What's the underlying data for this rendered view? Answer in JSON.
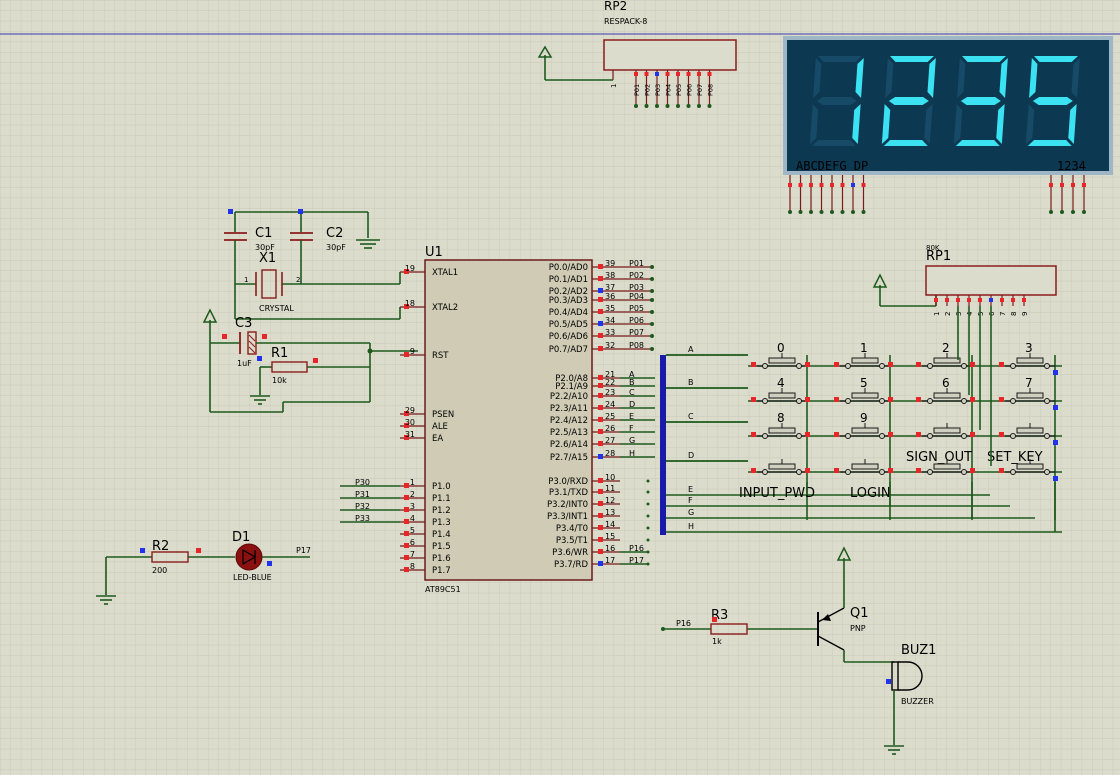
{
  "rp2": {
    "ref": "RP2",
    "value": "RESPACK-8",
    "pins": [
      "1"
    ],
    "outs": [
      "P01",
      "P02",
      "P03",
      "P04",
      "P05",
      "P06",
      "P07",
      "P08"
    ]
  },
  "display": {
    "digits": [
      "1",
      "2",
      "3",
      "5"
    ],
    "seg_label": "ABCDEFG DP",
    "digit_label": "1234"
  },
  "c1": {
    "ref": "C1",
    "value": "30pF"
  },
  "c2": {
    "ref": "C2",
    "value": "30pF"
  },
  "x1": {
    "ref": "X1",
    "value": "CRYSTAL",
    "pin1": "1",
    "pin2": "2"
  },
  "c3": {
    "ref": "C3",
    "value": "1uF"
  },
  "r1": {
    "ref": "R1",
    "value": "10k"
  },
  "u1": {
    "ref": "U1",
    "part": "AT89C51",
    "left": [
      {
        "num": "19",
        "name": "XTAL1"
      },
      {
        "num": "18",
        "name": "XTAL2"
      },
      {
        "num": "9",
        "name": "RST"
      },
      {
        "num": "29",
        "name": "PSEN"
      },
      {
        "num": "30",
        "name": "ALE"
      },
      {
        "num": "31",
        "name": "EA"
      },
      {
        "num": "1",
        "name": "P1.0",
        "net": "P30"
      },
      {
        "num": "2",
        "name": "P1.1",
        "net": "P31"
      },
      {
        "num": "3",
        "name": "P1.2",
        "net": "P32"
      },
      {
        "num": "4",
        "name": "P1.3",
        "net": "P33"
      },
      {
        "num": "5",
        "name": "P1.4"
      },
      {
        "num": "6",
        "name": "P1.5"
      },
      {
        "num": "7",
        "name": "P1.6"
      },
      {
        "num": "8",
        "name": "P1.7"
      }
    ],
    "right": [
      {
        "num": "39",
        "name": "P0.0/AD0",
        "net": "P01"
      },
      {
        "num": "38",
        "name": "P0.1/AD1",
        "net": "P02"
      },
      {
        "num": "37",
        "name": "P0.2/AD2",
        "net": "P03"
      },
      {
        "num": "36",
        "name": "P0.3/AD3",
        "net": "P04"
      },
      {
        "num": "35",
        "name": "P0.4/AD4",
        "net": "P05"
      },
      {
        "num": "34",
        "name": "P0.5/AD5",
        "net": "P06"
      },
      {
        "num": "33",
        "name": "P0.6/AD6",
        "net": "P07"
      },
      {
        "num": "32",
        "name": "P0.7/AD7",
        "net": "P08"
      },
      {
        "num": "21",
        "name": "P2.0/A8",
        "net": "A"
      },
      {
        "num": "22",
        "name": "P2.1/A9",
        "net": "B"
      },
      {
        "num": "23",
        "name": "P2.2/A10",
        "net": "C"
      },
      {
        "num": "24",
        "name": "P2.3/A11",
        "net": "D"
      },
      {
        "num": "25",
        "name": "P2.4/A12",
        "net": "E"
      },
      {
        "num": "26",
        "name": "P2.5/A13",
        "net": "F"
      },
      {
        "num": "27",
        "name": "P2.6/A14",
        "net": "G"
      },
      {
        "num": "28",
        "name": "P2.7/A15",
        "net": "H"
      },
      {
        "num": "10",
        "name": "P3.0/RXD"
      },
      {
        "num": "11",
        "name": "P3.1/TXD"
      },
      {
        "num": "12",
        "name": "P3.2/INT0"
      },
      {
        "num": "13",
        "name": "P3.3/INT1"
      },
      {
        "num": "14",
        "name": "P3.4/T0"
      },
      {
        "num": "15",
        "name": "P3.5/T1"
      },
      {
        "num": "16",
        "name": "P3.6/WR",
        "net": "P16"
      },
      {
        "num": "17",
        "name": "P3.7/RD",
        "net": "P17"
      }
    ]
  },
  "rp1": {
    "ref": "RP1",
    "value": "80K",
    "pins": [
      "1",
      "2",
      "3",
      "4",
      "5",
      "6",
      "7",
      "8",
      "9"
    ]
  },
  "bus": {
    "labels": [
      "A",
      "B",
      "C",
      "D",
      "E",
      "F",
      "G",
      "H"
    ]
  },
  "keys": {
    "labels": [
      "0",
      "1",
      "2",
      "3",
      "4",
      "5",
      "6",
      "7",
      "8",
      "9",
      "SIGN_OUT",
      "SET_KEY",
      "INPUT_PWD",
      "LOGIN"
    ]
  },
  "r2": {
    "ref": "R2",
    "value": "200"
  },
  "d1": {
    "ref": "D1",
    "value": "LED-BLUE",
    "net": "P17"
  },
  "r3": {
    "ref": "R3",
    "value": "1k",
    "net": "P16"
  },
  "q1": {
    "ref": "Q1",
    "value": "PNP"
  },
  "buz1": {
    "ref": "BUZ1",
    "value": "BUZZER"
  },
  "colors": {
    "background": "#dcdccc",
    "grid": "#c4c4b2",
    "wire": "#1d5a1d",
    "component": "#8b1c1c",
    "ic_fill": "#cfcbb4",
    "display_bg": "#0d3852",
    "segment_on": "#3be3f2",
    "pin_red": "#e8262a",
    "pin_blue": "#2233ee"
  }
}
